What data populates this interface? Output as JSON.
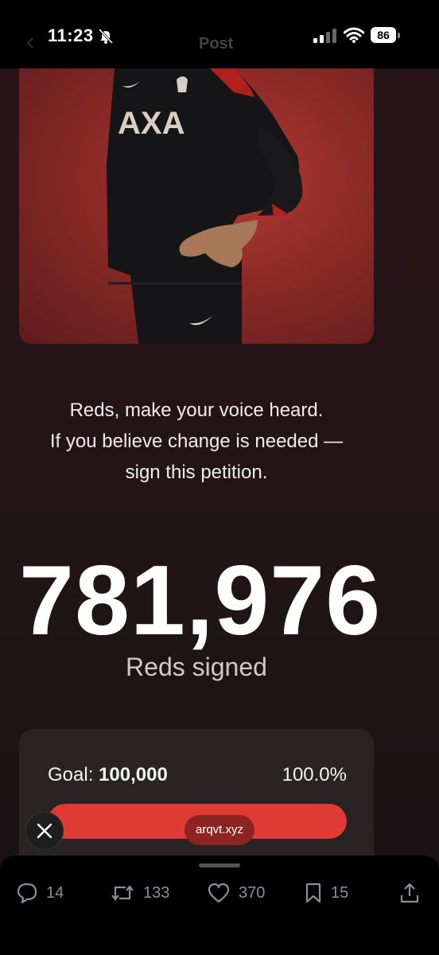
{
  "status_bar": {
    "time": "11:23",
    "battery": "86",
    "header_ghost": "Post"
  },
  "icons": {
    "bell": "bell-off-icon",
    "signal": "cellular-signal-icon",
    "wifi": "wifi-icon",
    "battery": "battery-icon",
    "close": "close-icon",
    "reply": "speech-bubble-icon",
    "repost": "repost-arrows-icon",
    "like": "heart-icon",
    "bookmark": "bookmark-icon",
    "share": "share-icon"
  },
  "hero": {
    "sponsor_text": "AXA"
  },
  "message": {
    "line1": "Reds, make your voice heard.",
    "line2": "If you believe change is needed —",
    "line3": "sign this petition."
  },
  "signatures": {
    "count": "781,976",
    "label": "Reds signed"
  },
  "goal": {
    "label": "Goal:",
    "value": "100,000",
    "percent_text": "100.0%",
    "progress": 1.0
  },
  "link_badge": "arqvt.xyz",
  "actions": {
    "replies": "14",
    "reposts": "133",
    "likes": "370",
    "bookmarks": "15"
  },
  "colors": {
    "accent_red": "#e03a34",
    "background": "#1d1214",
    "muted_icon": "#8b8f94"
  }
}
